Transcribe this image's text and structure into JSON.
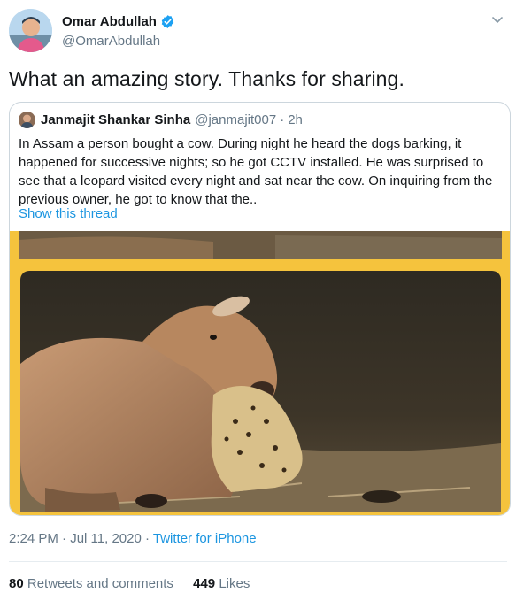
{
  "author": {
    "display_name": "Omar Abdullah",
    "handle": "@OmarAbdullah",
    "verified": true
  },
  "tweet": {
    "text": "What an amazing story. Thanks for sharing."
  },
  "quoted": {
    "display_name": "Janmajit Shankar Sinha",
    "handle": "@janmajit007",
    "separator": "·",
    "time": "2h",
    "text": "In Assam a person bought a cow. During night he heard the dogs barking, it happened for successive nights; so he got CCTV installed. He was surprised to see that a leopard visited every night and sat near the cow. On inquiring from the previous owner, he got to know that the..",
    "thread_link": "Show this thread",
    "media_border_color": "#f5c33d"
  },
  "meta": {
    "timestamp": "2:24 PM · Jul 11, 2020 · ",
    "source": "Twitter for iPhone"
  },
  "stats": {
    "retweets_count": "80",
    "retweets_label": "Retweets and comments",
    "likes_count": "449",
    "likes_label": "Likes"
  },
  "colors": {
    "link": "#1b95e0",
    "verified": "#1da1f2",
    "secondary_text": "#657786"
  }
}
